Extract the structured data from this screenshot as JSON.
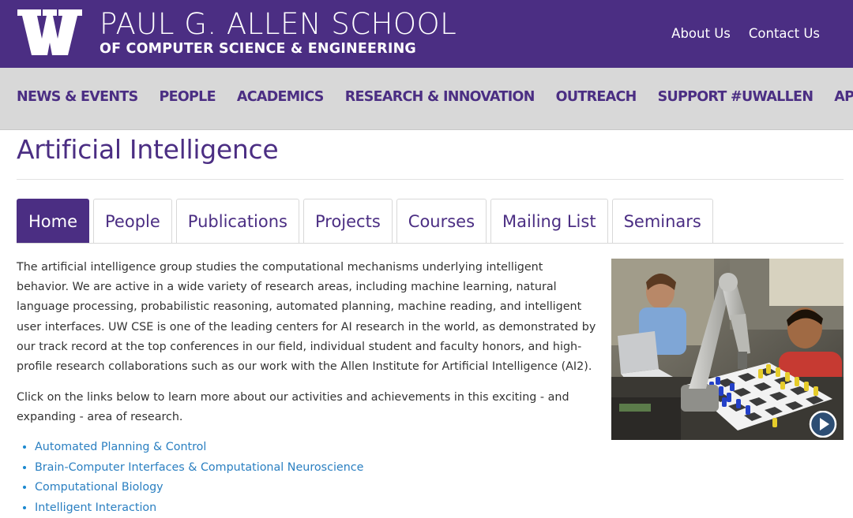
{
  "header": {
    "school_name": "PAUL G. ALLEN SCHOOL",
    "school_subtitle": "OF COMPUTER SCIENCE & ENGINEERING",
    "links": [
      "About Us",
      "Contact Us"
    ]
  },
  "nav": {
    "items": [
      "NEWS & EVENTS",
      "PEOPLE",
      "ACADEMICS",
      "RESEARCH & INNOVATION",
      "OUTREACH",
      "SUPPORT #UWALLEN",
      "APPLY!"
    ]
  },
  "page": {
    "title": "Artificial Intelligence"
  },
  "tabs": [
    "Home",
    "People",
    "Publications",
    "Projects",
    "Courses",
    "Mailing List",
    "Seminars"
  ],
  "active_tab": "Home",
  "content": {
    "intro": "The artificial intelligence group studies the computational mechanisms underlying intelligent behavior. We are active in a wide variety of research areas, including machine learning, natural language processing, probabilistic reasoning, automated planning, machine reading, and intelligent user interfaces. UW CSE is one of the leading centers for AI research in the world, as demonstrated by our track record at the top conferences in our field, individual student and faculty honors, and high-profile research collaborations such as our work with the Allen Institute for Artificial Intelligence (AI2).",
    "links_intro": "Click on the links below to learn more about our activities and achievements in this exciting - and expanding - area of research.",
    "research_areas": [
      "Automated Planning & Control",
      "Brain-Computer Interfaces & Computational Neuroscience",
      "Computational Biology",
      "Intelligent Interaction"
    ]
  },
  "colors": {
    "brand_purple": "#4b2e83",
    "nav_background": "#d8d8d8",
    "link_blue": "#2a7fc1"
  },
  "icons": [
    "uw-w-logo",
    "play-icon"
  ]
}
